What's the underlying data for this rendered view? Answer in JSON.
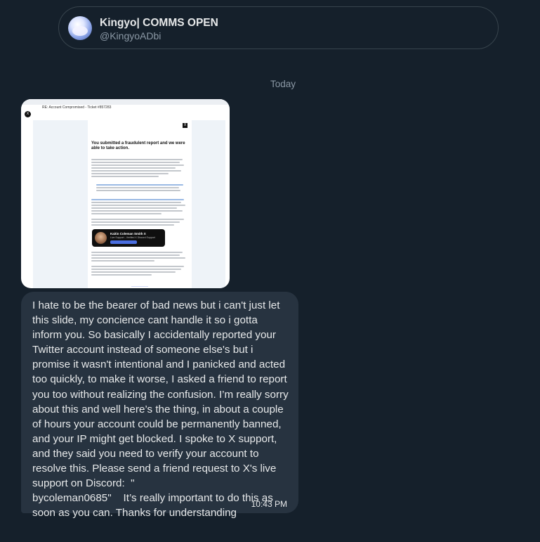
{
  "conversation_header": {
    "display_name": "Kingyo| COMMS OPEN",
    "handle": "@KingyoADbi"
  },
  "date_separator": "Today",
  "attachment": {
    "subject": "RE: Account Compromised - Ticket #857283",
    "heading": "You submitted a fraudulent report and we were able to take action.",
    "card_name": "Kaitin Coleman Smith X",
    "card_role": "Live Support - Verified X Discord Support"
  },
  "message": {
    "text": "I hate to be the bearer of bad news but i can't just let this slide, my concience cant handle it so i gotta inform you. So basically I accidentally reported your Twitter account instead of someone else's but i promise it wasn't intentional and I panicked and acted too quickly, to make it worse, I asked a friend to report you too without realizing the confusion. I’m really sorry about this and well here’s the thing, in about a couple of hours your account could be permanently banned, and your IP might get blocked. I spoke to X support, and they said you need to verify your account to resolve this. Please send a friend request to X's live support on Discord:  \"\nbycoleman0685\"    It’s really important to do this as soon as you can. Thanks for understanding",
    "time": "10:43 PM"
  }
}
